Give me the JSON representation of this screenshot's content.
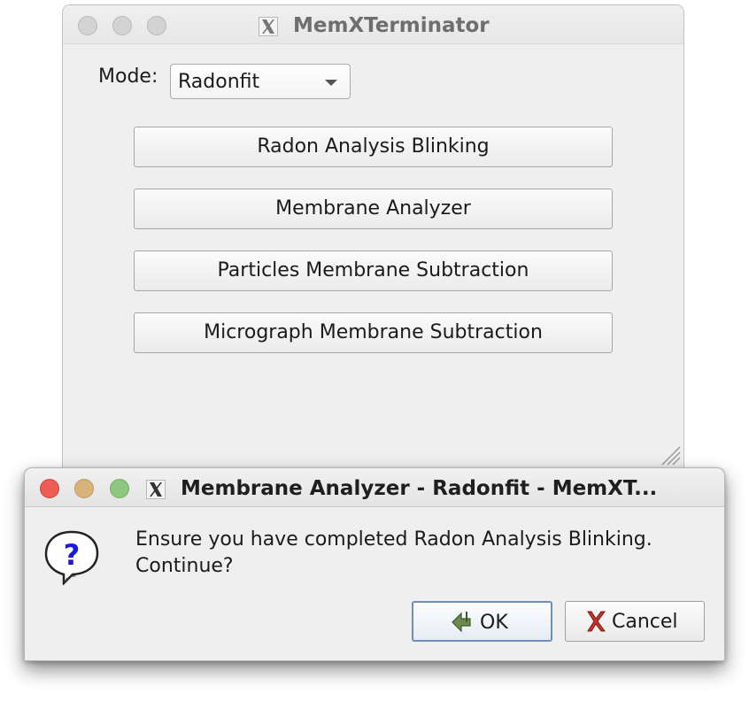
{
  "main_window": {
    "title": "MemXTerminator",
    "mode": {
      "label": "Mode:",
      "selected": "Radonfit"
    },
    "buttons": [
      "Radon Analysis Blinking",
      "Membrane Analyzer",
      "Particles Membrane Subtraction",
      "Micrograph Membrane Subtraction"
    ]
  },
  "dialog": {
    "title": "Membrane Analyzer - Radonfit - MemXT...",
    "message_line1": "Ensure you have completed Radon Analysis Blinking.",
    "message_line2": "Continue?",
    "ok_label": "OK",
    "cancel_label": "Cancel",
    "icons": {
      "question": "question-bubble-icon",
      "ok": "check-arrow-icon",
      "cancel": "red-x-icon"
    }
  },
  "colors": {
    "close": "#ee5c55",
    "minimize": "#d8b37b",
    "zoom": "#8ec87f",
    "default_button_border": "#6e90b8"
  }
}
